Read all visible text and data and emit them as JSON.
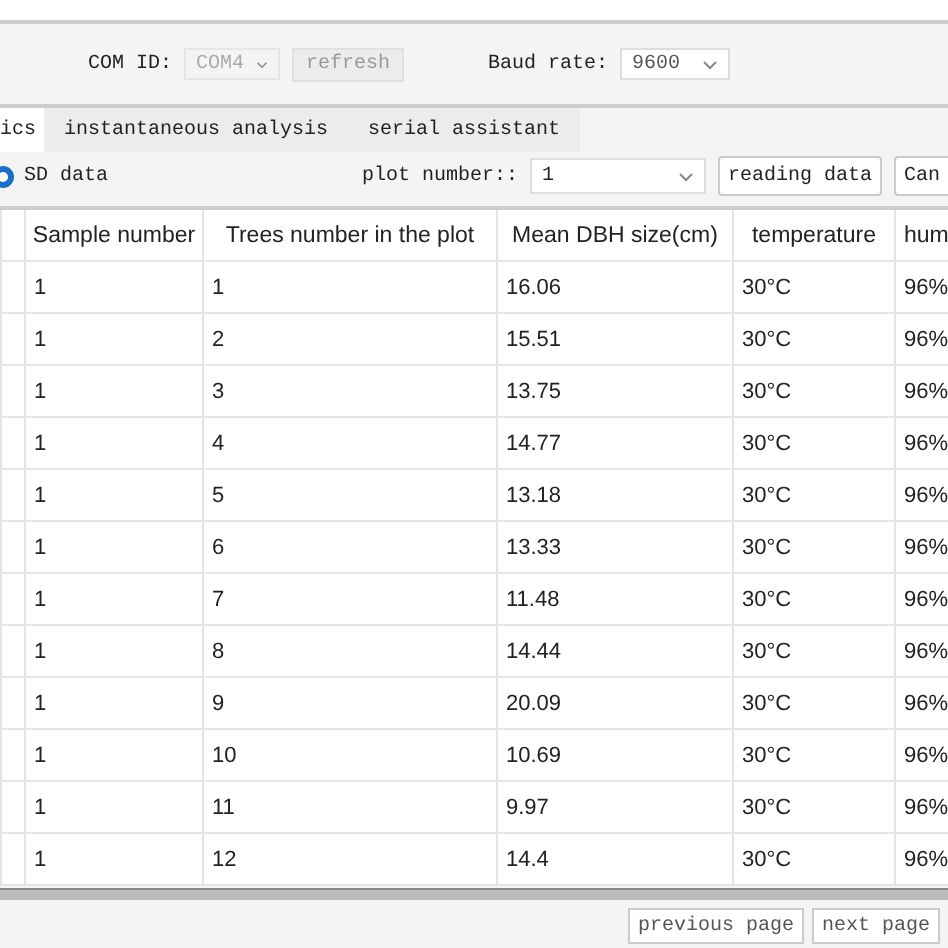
{
  "toolbar": {
    "com_label": "COM ID:",
    "com_value": "COM4",
    "refresh": "refresh",
    "baud_label": "Baud rate:",
    "baud_value": "9600"
  },
  "tabs": [
    {
      "label": "ics",
      "selected": true
    },
    {
      "label": "instantaneous analysis",
      "selected": false
    },
    {
      "label": "serial assistant",
      "selected": false
    }
  ],
  "controls": {
    "radio": {
      "label": "SD",
      "selected": true
    },
    "data_label": "data",
    "plot_label": "plot number::",
    "plot_value": "1",
    "reading_button": "reading data",
    "cut_button": "Can"
  },
  "table": {
    "columns": [
      "Sample number",
      "Trees number in the plot",
      "Mean DBH size(cm)",
      "temperature",
      "hum"
    ],
    "rows": [
      [
        "1",
        "1",
        "16.06",
        "30°C",
        "96%"
      ],
      [
        "1",
        "2",
        "15.51",
        "30°C",
        "96%"
      ],
      [
        "1",
        "3",
        "13.75",
        "30°C",
        "96%"
      ],
      [
        "1",
        "4",
        "14.77",
        "30°C",
        "96%"
      ],
      [
        "1",
        "5",
        "13.18",
        "30°C",
        "96%"
      ],
      [
        "1",
        "6",
        "13.33",
        "30°C",
        "96%"
      ],
      [
        "1",
        "7",
        "11.48",
        "30°C",
        "96%"
      ],
      [
        "1",
        "8",
        "14.44",
        "30°C",
        "96%"
      ],
      [
        "1",
        "9",
        "20.09",
        "30°C",
        "96%"
      ],
      [
        "1",
        "10",
        "10.69",
        "30°C",
        "96%"
      ],
      [
        "1",
        "11",
        "9.97",
        "30°C",
        "96%"
      ],
      [
        "1",
        "12",
        "14.4",
        "30°C",
        "96%"
      ]
    ]
  },
  "footer": {
    "previous": "previous page",
    "next": "next page"
  }
}
